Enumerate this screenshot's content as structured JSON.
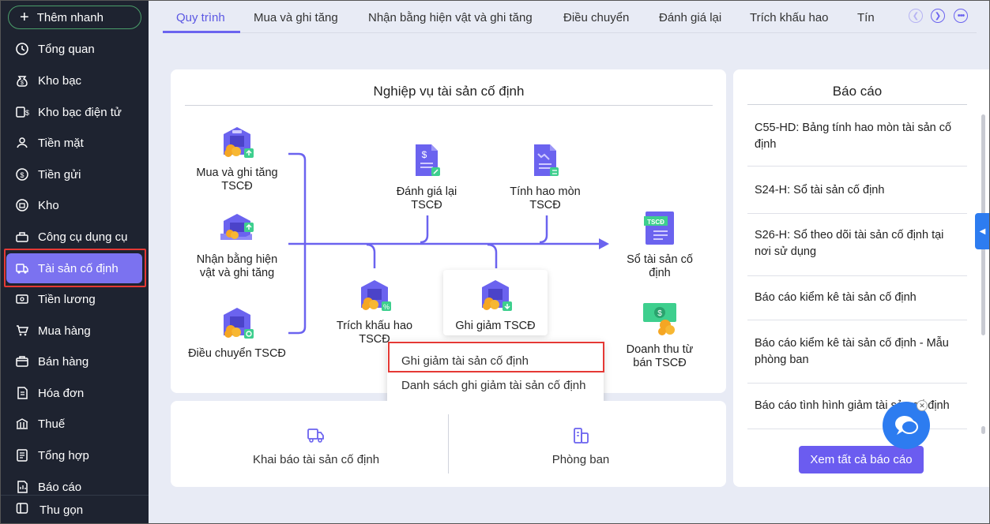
{
  "sidebar": {
    "quick_add": "Thêm nhanh",
    "items": [
      {
        "label": "Tổng quan",
        "icon": "home-icon"
      },
      {
        "label": "Kho bạc",
        "icon": "money-bag-icon"
      },
      {
        "label": "Kho bạc điện tử",
        "icon": "e-treasury-icon"
      },
      {
        "label": "Tiền mặt",
        "icon": "cash-icon"
      },
      {
        "label": "Tiền gửi",
        "icon": "deposit-icon"
      },
      {
        "label": "Kho",
        "icon": "warehouse-icon"
      },
      {
        "label": "Công cụ dụng cụ",
        "icon": "tools-icon"
      },
      {
        "label": "Tài sản cố định",
        "icon": "truck-icon"
      },
      {
        "label": "Tiền lương",
        "icon": "salary-icon"
      },
      {
        "label": "Mua hàng",
        "icon": "cart-icon"
      },
      {
        "label": "Bán hàng",
        "icon": "sell-icon"
      },
      {
        "label": "Hóa đơn",
        "icon": "invoice-icon"
      },
      {
        "label": "Thuế",
        "icon": "tax-icon"
      },
      {
        "label": "Tổng hợp",
        "icon": "summary-icon"
      },
      {
        "label": "Báo cáo",
        "icon": "report-icon"
      }
    ],
    "active_index": 7,
    "collapse": "Thu gọn"
  },
  "tabs": [
    "Quy trình",
    "Mua và ghi tăng",
    "Nhận bằng hiện vật và ghi tăng",
    "Điều chuyển",
    "Đánh giá lại",
    "Trích khấu hao",
    "Tín"
  ],
  "flow": {
    "title": "Nghiệp vụ tài sản cố định",
    "mua": "Mua và ghi tăng TSCĐ",
    "nhan": "Nhận bằng hiện vật và ghi tăng",
    "dieu_chuyen": "Điều chuyển TSCĐ",
    "danh_gia": "Đánh giá lại TSCĐ",
    "tinh_hao_mon": "Tính hao mòn TSCĐ",
    "trich_khau_hao": "Trích khấu hao TSCĐ",
    "ghi_giam": "Ghi giảm TSCĐ",
    "so_tai_san": "Sổ tài sản cố định",
    "doanh_thu": "Doanh thu từ bán TSCĐ",
    "tscd_tag": "TSCĐ"
  },
  "dropdown": {
    "opt1": "Ghi giảm tài sản cố định",
    "opt2": "Danh sách ghi giảm tài sản cố định"
  },
  "bottom": {
    "khai_bao": "Khai báo tài sản cố định",
    "phong_ban": "Phòng ban"
  },
  "reports": {
    "title": "Báo cáo",
    "items": [
      "C55-HD: Bảng tính hao mòn tài sản cố định",
      "S24-H: Sổ tài sản cố định",
      "S26-H: Sổ theo dõi tài sản cố định tại nơi sử dụng",
      "Báo cáo kiểm kê tài sản cố định",
      "Báo cáo kiểm kê tài sản cố định - Mẫu phòng ban",
      "Báo cáo tình hình giảm tài sản cố định"
    ],
    "view_all": "Xem tất cả báo cáo"
  }
}
